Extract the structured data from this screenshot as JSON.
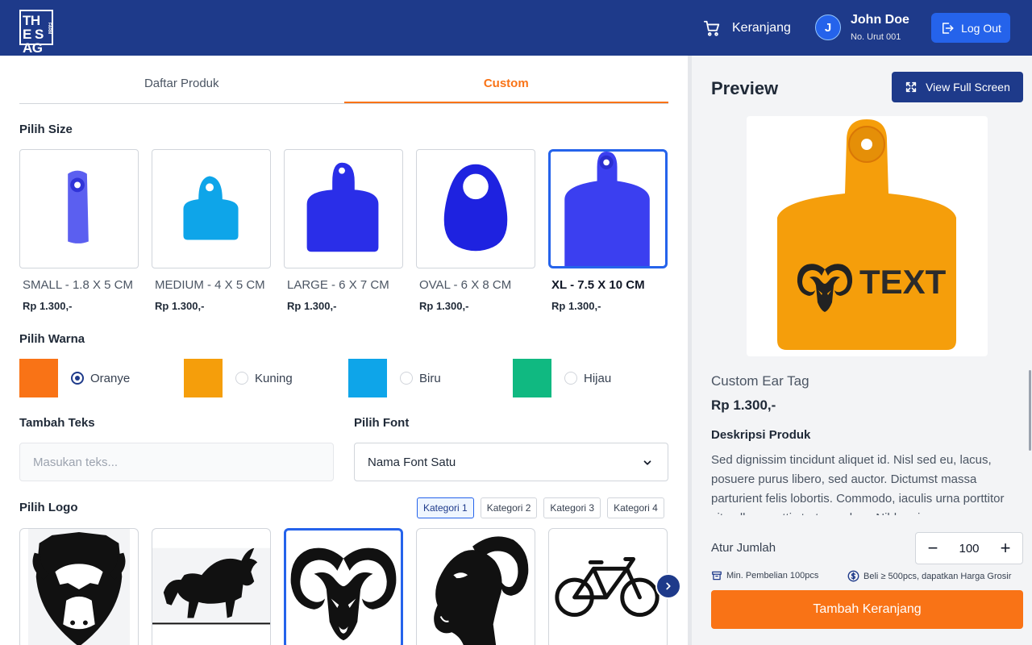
{
  "header": {
    "logo_text": "THE SAG",
    "logo_sub": "FARM",
    "cart_label": "Keranjang",
    "user_initial": "J",
    "user_name": "John Doe",
    "user_sub": "No. Urut 001",
    "logout_label": "Log Out"
  },
  "tabs": [
    {
      "label": "Daftar Produk",
      "active": false
    },
    {
      "label": "Custom",
      "active": true
    }
  ],
  "size_section": {
    "title": "Pilih Size",
    "items": [
      {
        "label": "SMALL - 1.8 X 5 CM",
        "price": "Rp 1.300,-",
        "color": "#5b5ff0",
        "shape": "small"
      },
      {
        "label": "MEDIUM - 4 X 5 CM",
        "price": "Rp 1.300,-",
        "color": "#0ea5e9",
        "shape": "medium"
      },
      {
        "label": "LARGE - 6 X 7 CM",
        "price": "Rp 1.300,-",
        "color": "#2a2ee8",
        "shape": "large"
      },
      {
        "label": "OVAL - 6 X 8 CM",
        "price": "Rp 1.300,-",
        "color": "#1e22e0",
        "shape": "oval"
      },
      {
        "label": "XL - 7.5 X 10 CM",
        "price": "Rp 1.300,-",
        "color": "#3b3ff0",
        "shape": "xl",
        "selected": true
      }
    ]
  },
  "color_section": {
    "title": "Pilih Warna",
    "items": [
      {
        "name": "Oranye",
        "hex": "#f97316",
        "selected": true
      },
      {
        "name": "Kuning",
        "hex": "#f59e0b",
        "selected": false
      },
      {
        "name": "Biru",
        "hex": "#0ea5e9",
        "selected": false
      },
      {
        "name": "Hijau",
        "hex": "#10b981",
        "selected": false
      }
    ]
  },
  "text_section": {
    "title": "Tambah Teks",
    "placeholder": "Masukan teks...",
    "value": ""
  },
  "font_section": {
    "title": "Pilih Font",
    "selected": "Nama Font Satu"
  },
  "logo_section": {
    "title": "Pilih Logo",
    "categories": [
      {
        "label": "Kategori 1",
        "active": true
      },
      {
        "label": "Kategori 2",
        "active": false
      },
      {
        "label": "Kategori 3",
        "active": false
      },
      {
        "label": "Kategori 4",
        "active": false
      }
    ],
    "items": [
      {
        "name": "bull-shield-logo",
        "selected": false
      },
      {
        "name": "charging-bull-logo",
        "selected": false
      },
      {
        "name": "ram-head-logo",
        "selected": true
      },
      {
        "name": "goat-profile-logo",
        "selected": false
      },
      {
        "name": "bicycle-logo",
        "selected": false
      }
    ]
  },
  "preview": {
    "title": "Preview",
    "fullscreen_label": "View Full Screen",
    "tag_text": "TEXT",
    "tag_color": "#f59e0b",
    "product_name": "Custom Ear Tag",
    "price": "Rp 1.300,-",
    "desc_title": "Deskripsi Produk",
    "description": "Sed dignissim tincidunt aliquet id. Nisl sed eu, lacus, posuere purus libero, sed auctor. Dictumst massa parturient felis lobortis. Commodo, iaculis urna porttitor sit nullam mattis tortor sed eu. Nibh enim.",
    "qty_label": "Atur Jumlah",
    "qty_value": "100",
    "note_min": "Min. Pembelian 100pcs",
    "note_wholesale": "Beli ≥ 500pcs, dapatkan Harga Grosir",
    "add_cart_label": "Tambah Keranjang"
  },
  "colors": {
    "primary": "#1e3a8a",
    "accent": "#f97316",
    "selection": "#2563eb"
  }
}
